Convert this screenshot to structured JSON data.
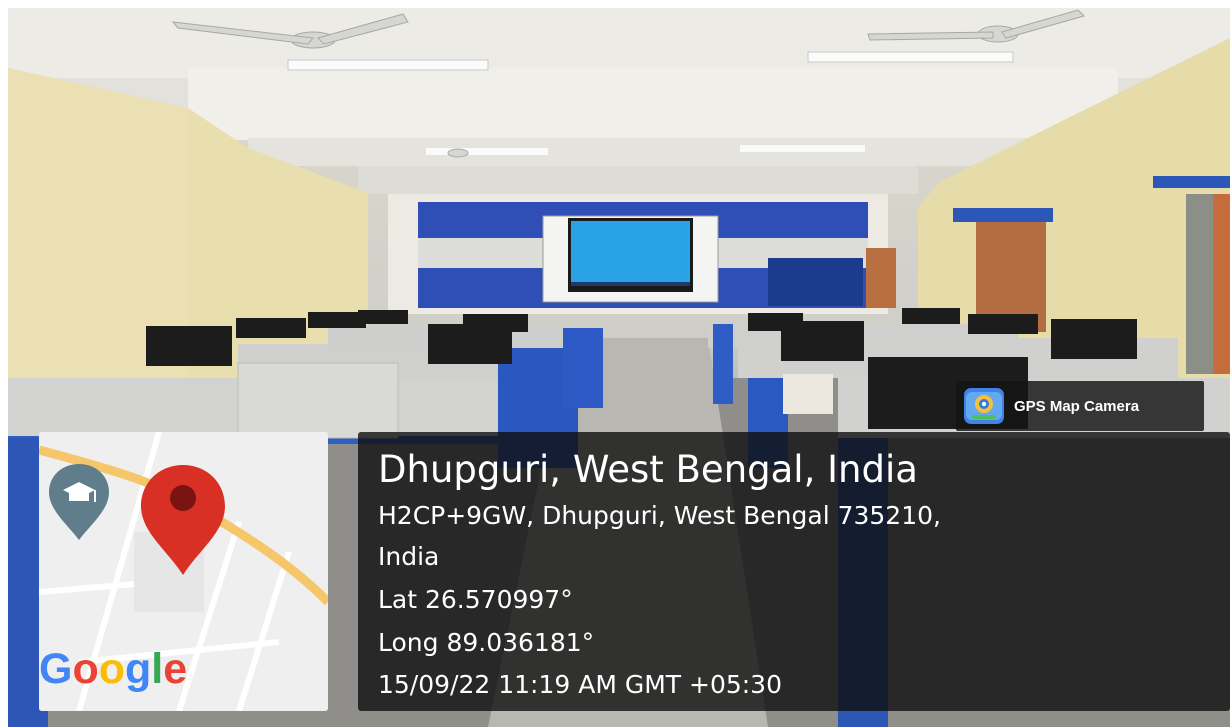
{
  "overlay": {
    "brand_label": "GPS Map Camera",
    "location_title": "Dhupguri, West Bengal, India",
    "address_line1": "H2CP+9GW, Dhupguri, West Bengal 735210,",
    "address_line2": "India",
    "latitude": "Lat 26.570997°",
    "longitude": "Long 89.036181°",
    "datetime": "15/09/22 11:19 AM GMT +05:30"
  },
  "map": {
    "logo_letters": [
      "G",
      "o",
      "o",
      "g",
      "l",
      "e"
    ],
    "logo_colors": [
      "#4285F4",
      "#EA4335",
      "#FBBC05",
      "#4285F4",
      "#34A853",
      "#EA4335"
    ],
    "pin_color": "#D93025",
    "school_marker_color": "#607D8B",
    "road_color": "#F5C76A"
  },
  "icons": {
    "gps_app": "gps-map-camera-icon",
    "school": "graduation-cap-icon",
    "pin": "map-pin-icon"
  }
}
